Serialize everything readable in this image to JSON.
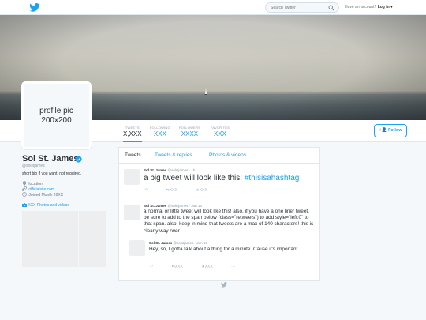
{
  "topbar": {
    "search_placeholder": "Search Twitter",
    "have_account": "Have an account?",
    "login": "Log in ▾"
  },
  "profile_pic": {
    "line1": "profile pic",
    "line2": "200x200"
  },
  "stats": [
    {
      "label": "TWEETS",
      "value": "X,XXX"
    },
    {
      "label": "FOLLOWING",
      "value": "XXX"
    },
    {
      "label": "FOLLOWERS",
      "value": "XXXX"
    },
    {
      "label": "FAVORITES",
      "value": "XXX"
    }
  ],
  "follow_label": "Follow",
  "profile": {
    "name": "Sol St. James",
    "handle": "@solstjames",
    "bio": "short bio if you want, not required.",
    "location": "location",
    "website": "officialsite.com",
    "joined": "Joined Month 20XX",
    "photos_link": "XXX Photos and videos"
  },
  "tabs": [
    "Tweets",
    "Tweets & replies",
    "Photos & videos"
  ],
  "tweets": [
    {
      "name": "Sol St. James",
      "handle": "@solstjames",
      "time": "1h",
      "text": "a big tweet will look like this!",
      "hashtag": "#thisisahashtag",
      "retweets": "XXX",
      "favorites": "XXX"
    },
    {
      "name": "Sol St. James",
      "handle": "@solstjames",
      "time": "Jun 16",
      "text": "a normal or little tweet will look like this! also, if you have a one liner tweet, be sure to add to the span below (class=\"retweets\") to add style=\"left:0\" to that span. also, keep in mind that tweets are a max of 140 characters! this is clearly way over...",
      "reply": {
        "name": "Sol St. James",
        "handle": "@solstjames",
        "time": "Jun 16",
        "text": "Hey, so, I gotta talk about a thing for a minute. Cause it's important.",
        "retweets": "XXX",
        "favorites": "XXX"
      }
    }
  ],
  "colors": {
    "accent": "#1da1f2",
    "background": "#f5f8fa"
  }
}
